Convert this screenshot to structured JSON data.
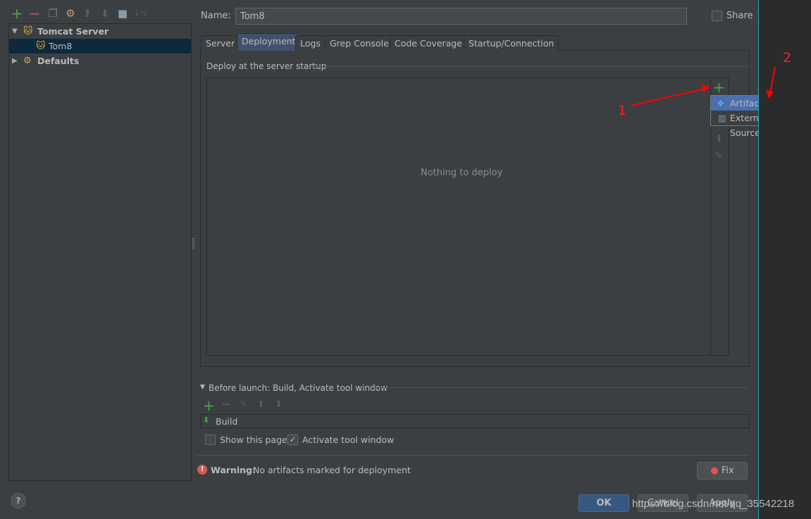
{
  "toolbar": {
    "icons": [
      "add-icon",
      "remove-icon",
      "copy-icon",
      "wrench-icon",
      "move-up-icon",
      "move-down-icon",
      "folder-icon",
      "sort-az-icon"
    ]
  },
  "tree": {
    "items": [
      {
        "label": "Tomcat Server",
        "icon": "tomcat-icon",
        "expanded": true
      },
      {
        "label": "Tom8",
        "icon": "tomcat-run-config-icon",
        "selected": true
      },
      {
        "label": "Defaults",
        "icon": "wrench-icon",
        "expanded": false
      }
    ]
  },
  "name_field": {
    "label": "Name:",
    "value": "Tom8"
  },
  "share": {
    "label": "Share",
    "checked": false
  },
  "tabs": [
    {
      "label": "Server"
    },
    {
      "label": "Deployment",
      "active": true
    },
    {
      "label": "Logs"
    },
    {
      "label": "Grep Console"
    },
    {
      "label": "Code Coverage"
    },
    {
      "label": "Startup/Connection"
    }
  ],
  "deployment": {
    "section_title": "Deploy at the server startup",
    "empty_text": "Nothing to deploy"
  },
  "add_menu": {
    "items": [
      {
        "label": "Artifact...",
        "icon": "artifact-icon",
        "highlighted": true
      },
      {
        "label": "External Source...",
        "icon": "zip-icon"
      }
    ]
  },
  "before_launch": {
    "title": "Before launch: Build, Activate tool window",
    "tasks": [
      {
        "label": "Build",
        "icon": "build-icon"
      }
    ],
    "show_page": {
      "label": "Show this page",
      "checked": false
    },
    "activate_tool_window": {
      "label": "Activate tool window",
      "checked": true
    }
  },
  "warning": {
    "prefix": "Warning:",
    "text": "No artifacts marked for deployment",
    "fix_label": "Fix"
  },
  "buttons": {
    "ok": "OK",
    "cancel": "Cancel",
    "apply": "Apply"
  },
  "annotations": {
    "one": "1",
    "two": "2",
    "color": "#ff0000"
  },
  "watermark": "https://blog.csdn.net/qq_35542218",
  "colors": {
    "background": "#3c3f41",
    "selection": "#0d293e",
    "active_tab": "#41516d",
    "menu_highlight": "#4b6eaf",
    "accent_green": "#49a64a"
  }
}
